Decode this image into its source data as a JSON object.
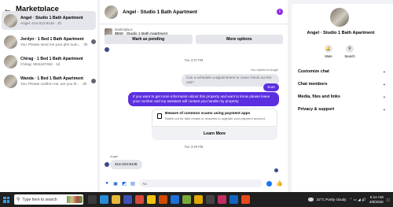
{
  "sidebar": {
    "title": "Marketplace",
    "conversations": [
      {
        "name": "Angel · Studio 1 Bath Apartment",
        "sub": "Angel: 414-313-8145 · 2h"
      },
      {
        "name": "Jordyn · 1 Bed 1 Bath Apartment",
        "sub": "You: Please send me your phn num... · 3h"
      },
      {
        "name": "Chirag · 1 Bed 1 Bath Apartment",
        "sub": "Chirag: 8511187462 · 1d"
      },
      {
        "name": "Wanda · 1 Bed 1 Bath Apartment",
        "sub": "You: Please confirm me, are you th... · 3h"
      }
    ]
  },
  "chat": {
    "title": "Angel · Studio 1 Bath Apartment",
    "info_icon": "i",
    "listing": {
      "source": "Marketplace",
      "price": "$550 · Studio 1 Bath Apartment"
    },
    "buttons": {
      "pending": "Mark as pending",
      "more": "More options"
    },
    "time1": "Tue 3:37 PM",
    "replied_to": "You replied to Angel",
    "quoted": "Can a schedule a appointment to come check out the unit?",
    "sure": "Sure",
    "long_msg": "If you want to get more information about this property and want to know please leave your number and my assistant will contact you.handle my property",
    "warning": {
      "title": "Beware of common scams using payment apps",
      "sub": "Watch out for fake emails or requests to upgrade your payment account.",
      "learn": "Learn More"
    },
    "time2": "Tue 3:39 PM",
    "sender": "Angel",
    "phone": "414-313-8145",
    "composer_placeholder": "Aa"
  },
  "details": {
    "name": "Angel · Studio 1 Bath Apartment",
    "actions": [
      {
        "label": "Mute"
      },
      {
        "label": "Search"
      }
    ],
    "sections": [
      "Customize chat",
      "Chat members",
      "Media, files and links",
      "Privacy & support"
    ]
  },
  "taskbar": {
    "search_placeholder": "Type here to search",
    "weather": "22°C  Partly cloudy",
    "time": "6:14 AM",
    "date": "4/8/2026"
  }
}
